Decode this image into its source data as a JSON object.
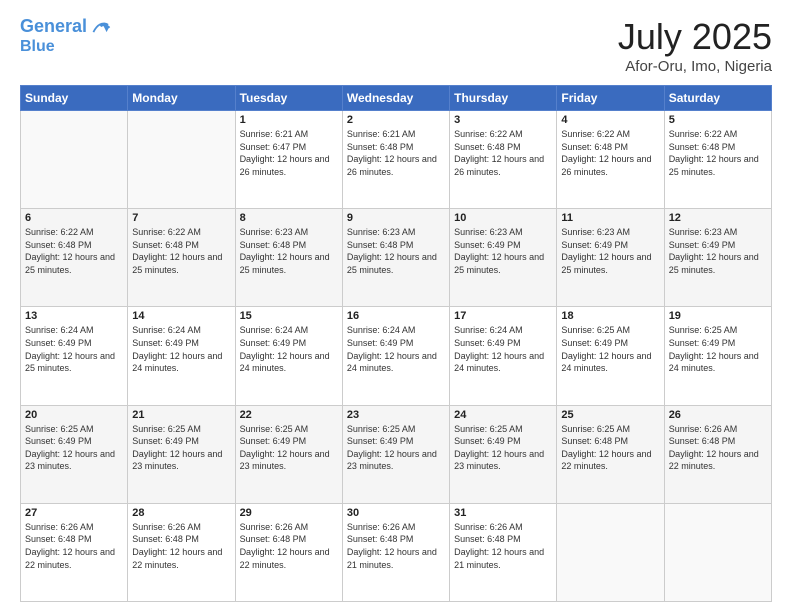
{
  "header": {
    "logo_line1": "General",
    "logo_line2": "Blue",
    "month": "July 2025",
    "location": "Afor-Oru, Imo, Nigeria"
  },
  "days_of_week": [
    "Sunday",
    "Monday",
    "Tuesday",
    "Wednesday",
    "Thursday",
    "Friday",
    "Saturday"
  ],
  "weeks": [
    [
      {
        "day": "",
        "sunrise": "",
        "sunset": "",
        "daylight": ""
      },
      {
        "day": "",
        "sunrise": "",
        "sunset": "",
        "daylight": ""
      },
      {
        "day": "1",
        "sunrise": "Sunrise: 6:21 AM",
        "sunset": "Sunset: 6:47 PM",
        "daylight": "Daylight: 12 hours and 26 minutes."
      },
      {
        "day": "2",
        "sunrise": "Sunrise: 6:21 AM",
        "sunset": "Sunset: 6:48 PM",
        "daylight": "Daylight: 12 hours and 26 minutes."
      },
      {
        "day": "3",
        "sunrise": "Sunrise: 6:22 AM",
        "sunset": "Sunset: 6:48 PM",
        "daylight": "Daylight: 12 hours and 26 minutes."
      },
      {
        "day": "4",
        "sunrise": "Sunrise: 6:22 AM",
        "sunset": "Sunset: 6:48 PM",
        "daylight": "Daylight: 12 hours and 26 minutes."
      },
      {
        "day": "5",
        "sunrise": "Sunrise: 6:22 AM",
        "sunset": "Sunset: 6:48 PM",
        "daylight": "Daylight: 12 hours and 25 minutes."
      }
    ],
    [
      {
        "day": "6",
        "sunrise": "Sunrise: 6:22 AM",
        "sunset": "Sunset: 6:48 PM",
        "daylight": "Daylight: 12 hours and 25 minutes."
      },
      {
        "day": "7",
        "sunrise": "Sunrise: 6:22 AM",
        "sunset": "Sunset: 6:48 PM",
        "daylight": "Daylight: 12 hours and 25 minutes."
      },
      {
        "day": "8",
        "sunrise": "Sunrise: 6:23 AM",
        "sunset": "Sunset: 6:48 PM",
        "daylight": "Daylight: 12 hours and 25 minutes."
      },
      {
        "day": "9",
        "sunrise": "Sunrise: 6:23 AM",
        "sunset": "Sunset: 6:48 PM",
        "daylight": "Daylight: 12 hours and 25 minutes."
      },
      {
        "day": "10",
        "sunrise": "Sunrise: 6:23 AM",
        "sunset": "Sunset: 6:49 PM",
        "daylight": "Daylight: 12 hours and 25 minutes."
      },
      {
        "day": "11",
        "sunrise": "Sunrise: 6:23 AM",
        "sunset": "Sunset: 6:49 PM",
        "daylight": "Daylight: 12 hours and 25 minutes."
      },
      {
        "day": "12",
        "sunrise": "Sunrise: 6:23 AM",
        "sunset": "Sunset: 6:49 PM",
        "daylight": "Daylight: 12 hours and 25 minutes."
      }
    ],
    [
      {
        "day": "13",
        "sunrise": "Sunrise: 6:24 AM",
        "sunset": "Sunset: 6:49 PM",
        "daylight": "Daylight: 12 hours and 25 minutes."
      },
      {
        "day": "14",
        "sunrise": "Sunrise: 6:24 AM",
        "sunset": "Sunset: 6:49 PM",
        "daylight": "Daylight: 12 hours and 24 minutes."
      },
      {
        "day": "15",
        "sunrise": "Sunrise: 6:24 AM",
        "sunset": "Sunset: 6:49 PM",
        "daylight": "Daylight: 12 hours and 24 minutes."
      },
      {
        "day": "16",
        "sunrise": "Sunrise: 6:24 AM",
        "sunset": "Sunset: 6:49 PM",
        "daylight": "Daylight: 12 hours and 24 minutes."
      },
      {
        "day": "17",
        "sunrise": "Sunrise: 6:24 AM",
        "sunset": "Sunset: 6:49 PM",
        "daylight": "Daylight: 12 hours and 24 minutes."
      },
      {
        "day": "18",
        "sunrise": "Sunrise: 6:25 AM",
        "sunset": "Sunset: 6:49 PM",
        "daylight": "Daylight: 12 hours and 24 minutes."
      },
      {
        "day": "19",
        "sunrise": "Sunrise: 6:25 AM",
        "sunset": "Sunset: 6:49 PM",
        "daylight": "Daylight: 12 hours and 24 minutes."
      }
    ],
    [
      {
        "day": "20",
        "sunrise": "Sunrise: 6:25 AM",
        "sunset": "Sunset: 6:49 PM",
        "daylight": "Daylight: 12 hours and 23 minutes."
      },
      {
        "day": "21",
        "sunrise": "Sunrise: 6:25 AM",
        "sunset": "Sunset: 6:49 PM",
        "daylight": "Daylight: 12 hours and 23 minutes."
      },
      {
        "day": "22",
        "sunrise": "Sunrise: 6:25 AM",
        "sunset": "Sunset: 6:49 PM",
        "daylight": "Daylight: 12 hours and 23 minutes."
      },
      {
        "day": "23",
        "sunrise": "Sunrise: 6:25 AM",
        "sunset": "Sunset: 6:49 PM",
        "daylight": "Daylight: 12 hours and 23 minutes."
      },
      {
        "day": "24",
        "sunrise": "Sunrise: 6:25 AM",
        "sunset": "Sunset: 6:49 PM",
        "daylight": "Daylight: 12 hours and 23 minutes."
      },
      {
        "day": "25",
        "sunrise": "Sunrise: 6:25 AM",
        "sunset": "Sunset: 6:48 PM",
        "daylight": "Daylight: 12 hours and 22 minutes."
      },
      {
        "day": "26",
        "sunrise": "Sunrise: 6:26 AM",
        "sunset": "Sunset: 6:48 PM",
        "daylight": "Daylight: 12 hours and 22 minutes."
      }
    ],
    [
      {
        "day": "27",
        "sunrise": "Sunrise: 6:26 AM",
        "sunset": "Sunset: 6:48 PM",
        "daylight": "Daylight: 12 hours and 22 minutes."
      },
      {
        "day": "28",
        "sunrise": "Sunrise: 6:26 AM",
        "sunset": "Sunset: 6:48 PM",
        "daylight": "Daylight: 12 hours and 22 minutes."
      },
      {
        "day": "29",
        "sunrise": "Sunrise: 6:26 AM",
        "sunset": "Sunset: 6:48 PM",
        "daylight": "Daylight: 12 hours and 22 minutes."
      },
      {
        "day": "30",
        "sunrise": "Sunrise: 6:26 AM",
        "sunset": "Sunset: 6:48 PM",
        "daylight": "Daylight: 12 hours and 21 minutes."
      },
      {
        "day": "31",
        "sunrise": "Sunrise: 6:26 AM",
        "sunset": "Sunset: 6:48 PM",
        "daylight": "Daylight: 12 hours and 21 minutes."
      },
      {
        "day": "",
        "sunrise": "",
        "sunset": "",
        "daylight": ""
      },
      {
        "day": "",
        "sunrise": "",
        "sunset": "",
        "daylight": ""
      }
    ]
  ]
}
